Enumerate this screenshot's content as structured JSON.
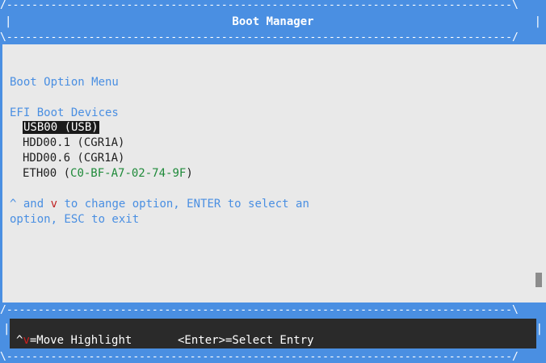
{
  "header": {
    "title": "Boot Manager",
    "rule_top": "/--------------------------------------------------------------------------------\\",
    "rule_bottom": "\\--------------------------------------------------------------------------------/"
  },
  "menu": {
    "heading": "Boot Option Menu",
    "devices_heading": "EFI Boot Devices",
    "devices": [
      {
        "label": "USB00 (USB)",
        "selected": true
      },
      {
        "label": "HDD00.1 (CGR1A)",
        "selected": false
      },
      {
        "label": "HDD00.6 (CGR1A)",
        "selected": false
      },
      {
        "label_prefix": "ETH00 (",
        "mac": "C0-BF-A7-02-74-9F",
        "label_suffix": ")",
        "selected": false
      }
    ],
    "help_line1_prefix": "^ and ",
    "help_line1_key": "v",
    "help_line1_suffix": " to change option, ENTER to select an",
    "help_line2": "option, ESC to exit"
  },
  "footer": {
    "rule_top": "/--------------------------------------------------------------------------------\\",
    "rule_bottom": "\\--------------------------------------------------------------------------------/",
    "move_key": "^v",
    "move_label": "=Move Highlight",
    "select_label": "<Enter>=Select Entry"
  },
  "colors": {
    "frame_blue": "#4a8fe2",
    "background": "#e9e9e9",
    "selection_bg": "#1a1a1a",
    "mac_green": "#1f8a3a",
    "key_red": "#c02020"
  }
}
